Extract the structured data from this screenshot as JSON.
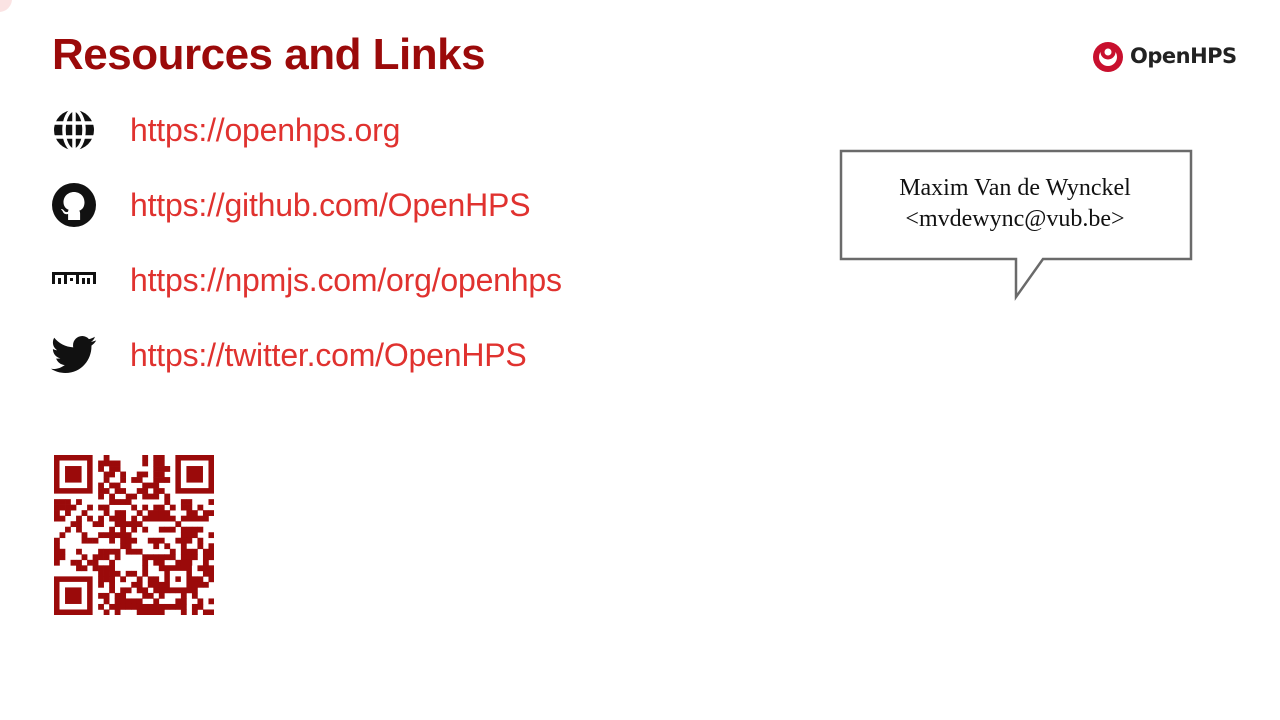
{
  "slide": {
    "title": "Resources and Links"
  },
  "logo": {
    "text": "OpenHPS",
    "color": "#c8102e"
  },
  "links": [
    {
      "icon": "globe-icon",
      "url": "https://openhps.org"
    },
    {
      "icon": "github-icon",
      "url": "https://github.com/OpenHPS"
    },
    {
      "icon": "npm-icon",
      "url": "https://npmjs.com/org/openhps"
    },
    {
      "icon": "twitter-icon",
      "url": "https://twitter.com/OpenHPS"
    }
  ],
  "qr_code": {
    "icon": "qr-code",
    "color": "#9b0a0a"
  },
  "speech_bubble": {
    "name": "Maxim Van de Wynckel",
    "email": "<mvdewync@vub.be>"
  },
  "colors": {
    "title": "#9b0a0a",
    "link": "#e0322f",
    "icon": "#111111"
  }
}
